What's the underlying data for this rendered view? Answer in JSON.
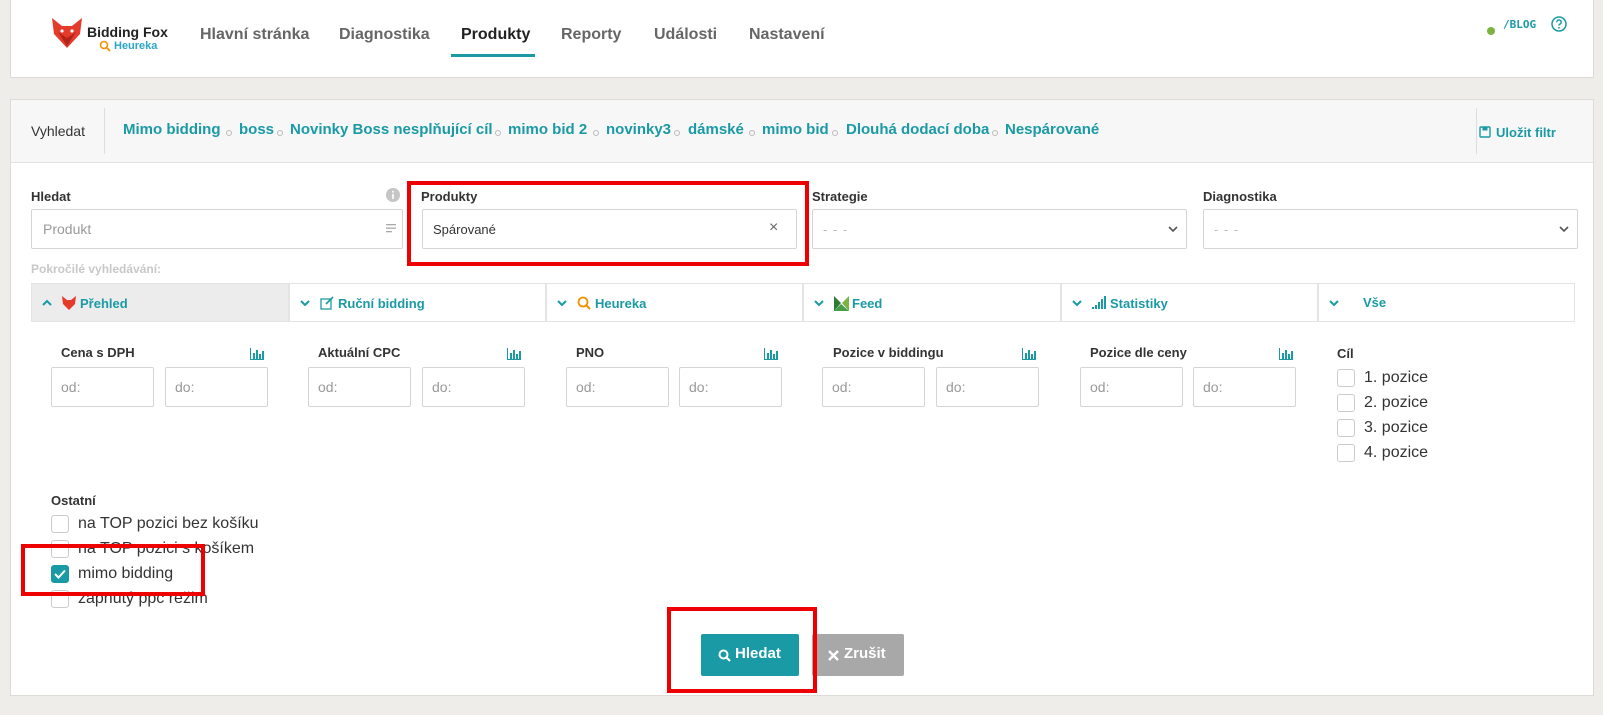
{
  "brand": {
    "name": "Bidding Fox",
    "sub": "Heureka"
  },
  "nav": [
    {
      "label": "Hlavní stránka"
    },
    {
      "label": "Diagnostika"
    },
    {
      "label": "Produkty"
    },
    {
      "label": "Reporty"
    },
    {
      "label": "Události"
    },
    {
      "label": "Nastavení"
    }
  ],
  "topright": {
    "blog": "/BLOG"
  },
  "filterbar": {
    "search_label": "Vyhledat",
    "saved_filters": [
      "Mimo bidding",
      "boss",
      "Novinky Boss nesplňující cíl",
      "mimo bid 2",
      "novinky3",
      "dámské",
      "mimo bid",
      "Dlouhá dodací doba",
      "Nespárované"
    ],
    "save_label": "Uložit filtr"
  },
  "fields": {
    "hledat": {
      "label": "Hledat",
      "placeholder": "Produkt"
    },
    "produkty": {
      "label": "Produkty",
      "value": "Spárované",
      "clear": "×"
    },
    "strategie": {
      "label": "Strategie",
      "value": "- - -"
    },
    "diagnostika": {
      "label": "Diagnostika",
      "value": "- - -"
    }
  },
  "advanced_label": "Pokročilé vyhledávání:",
  "tabs": [
    {
      "label": "Přehled"
    },
    {
      "label": "Ruční bidding"
    },
    {
      "label": "Heureka"
    },
    {
      "label": "Feed"
    },
    {
      "label": "Statistiky"
    },
    {
      "label": "Vše"
    }
  ],
  "ranges": [
    {
      "label": "Cena s DPH",
      "from": "od:",
      "to": "do:"
    },
    {
      "label": "Aktuální CPC",
      "from": "od:",
      "to": "do:"
    },
    {
      "label": "PNO",
      "from": "od:",
      "to": "do:"
    },
    {
      "label": "Pozice v biddingu",
      "from": "od:",
      "to": "do:"
    },
    {
      "label": "Pozice dle ceny",
      "from": "od:",
      "to": "do:"
    }
  ],
  "cil": {
    "label": "Cíl",
    "options": [
      "1. pozice",
      "2. pozice",
      "3. pozice",
      "4. pozice"
    ]
  },
  "ostatni": {
    "label": "Ostatní",
    "options": [
      "na TOP pozici bez košíku",
      "na TOP pozici s košíkem",
      "mimo bidding",
      "zapnutý ppc režim"
    ],
    "checked": [
      false,
      false,
      true,
      false
    ]
  },
  "buttons": {
    "search": "Hledat",
    "cancel": "Zrušit"
  },
  "colors": {
    "accent": "#1a9aa5",
    "highlight": "#e00000",
    "heureka_orange": "#f39200"
  }
}
